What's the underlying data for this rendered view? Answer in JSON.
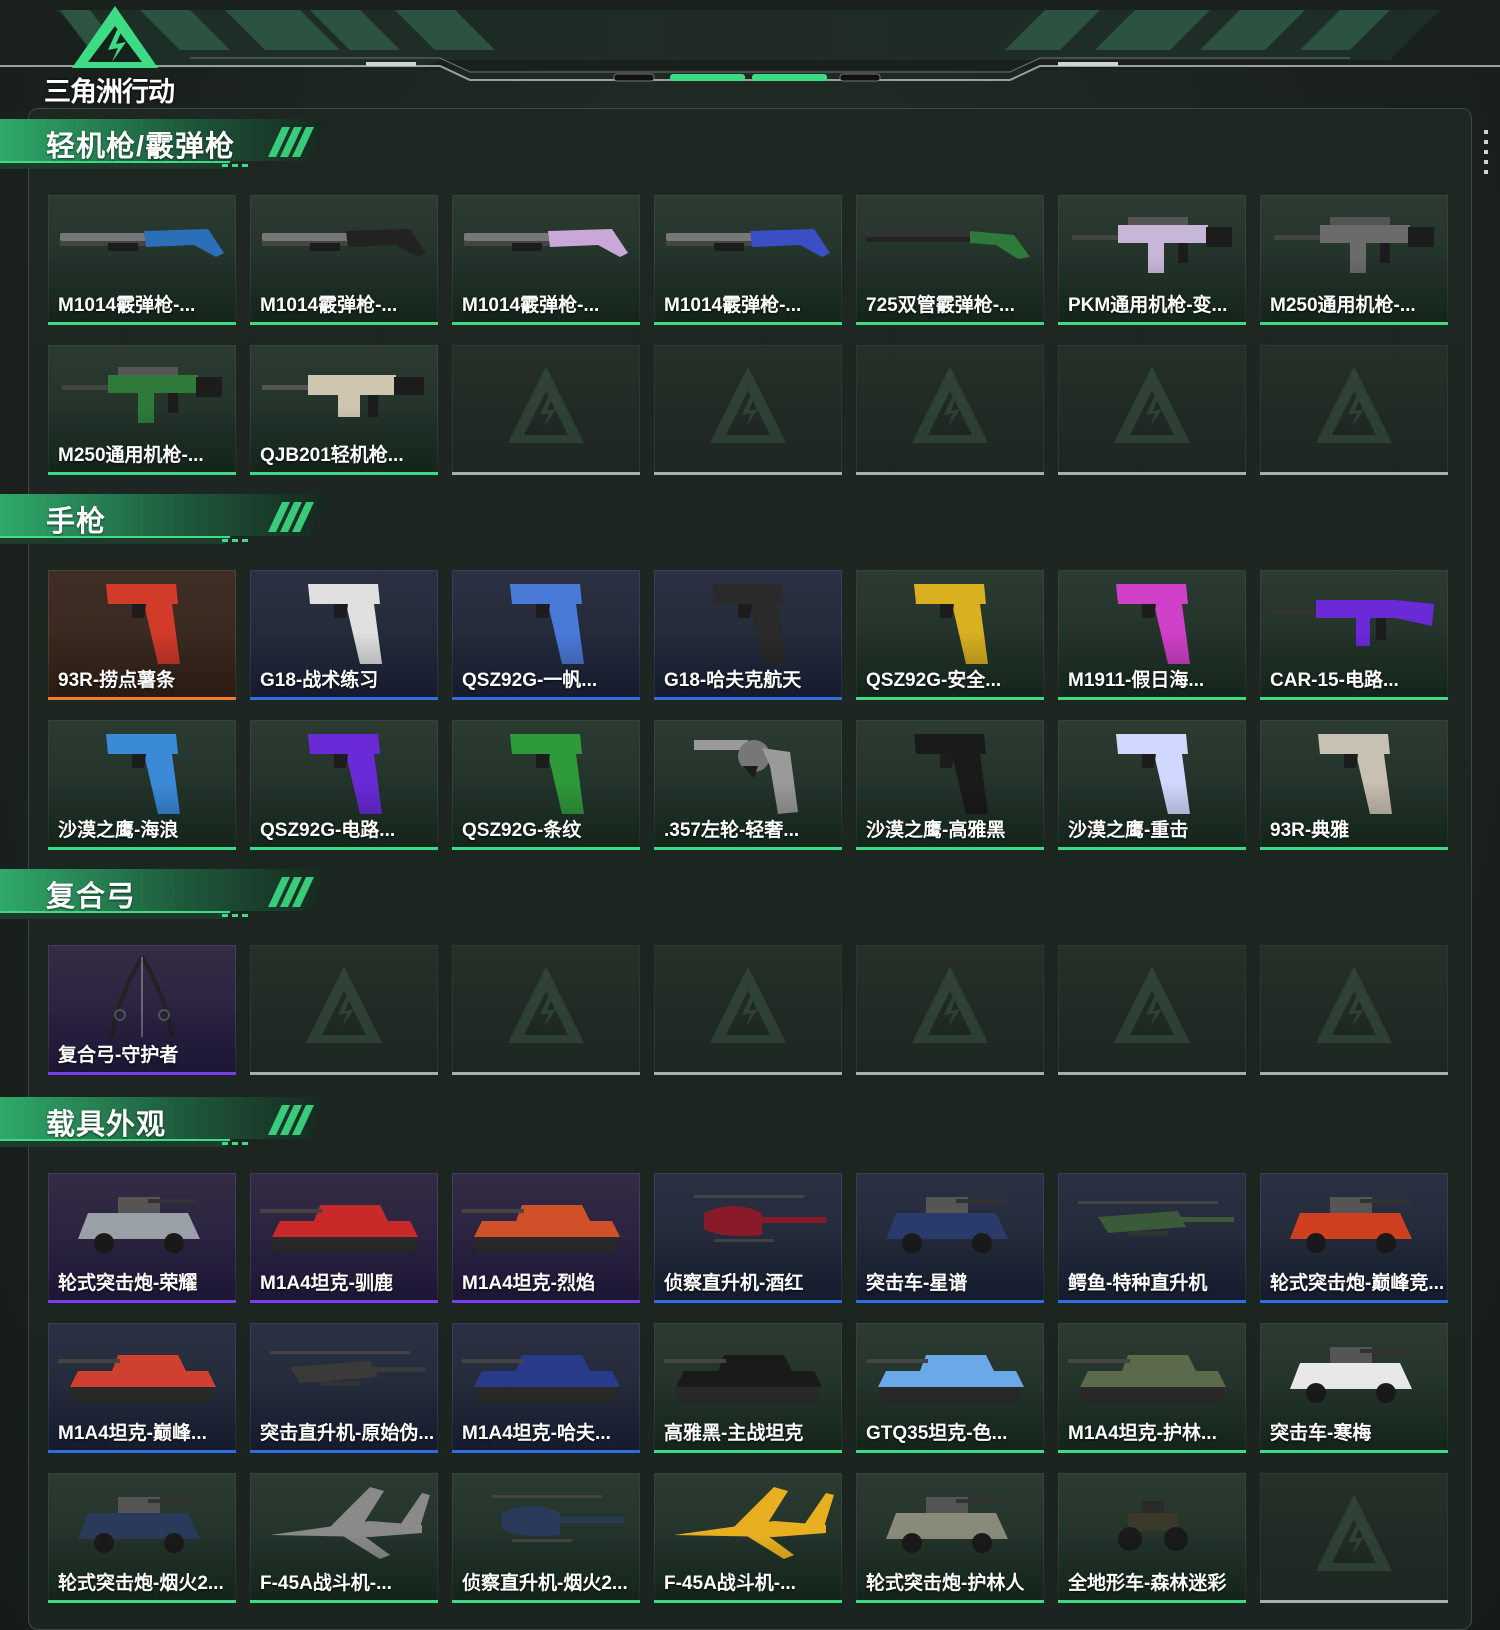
{
  "header": {
    "logo_text": "三角洲行动"
  },
  "colors": {
    "accent": "#3ddc84",
    "blue": "#2f6ee0",
    "purple": "#7a3ee6",
    "orange": "#f07c28",
    "empty": "#a9b0ac"
  },
  "sections": [
    {
      "title": "轻机枪/霰弹枪",
      "items": [
        {
          "label": "M1014霰弹枪-...",
          "rarity": "green",
          "icon": "shotgun-icon",
          "tint": "#2a6fb8"
        },
        {
          "label": "M1014霰弹枪-...",
          "rarity": "green",
          "icon": "shotgun-icon",
          "tint": "#222222"
        },
        {
          "label": "M1014霰弹枪-...",
          "rarity": "green",
          "icon": "shotgun-icon",
          "tint": "#c9a7d6"
        },
        {
          "label": "M1014霰弹枪-...",
          "rarity": "green",
          "icon": "shotgun-icon",
          "tint": "#3a4fc4"
        },
        {
          "label": "725双管霰弹枪-...",
          "rarity": "green",
          "icon": "double-barrel-shotgun-icon",
          "tint": "#2f7a3a"
        },
        {
          "label": "PKM通用机枪-变...",
          "rarity": "green",
          "icon": "machine-gun-icon",
          "tint": "#c8b6d8"
        },
        {
          "label": "M250通用机枪-...",
          "rarity": "green",
          "icon": "machine-gun-icon",
          "tint": "#6b6b6b"
        },
        {
          "label": "M250通用机枪-...",
          "rarity": "green",
          "icon": "machine-gun-icon",
          "tint": "#2f7a3a"
        },
        {
          "label": "QJB201轻机枪...",
          "rarity": "green",
          "icon": "light-machine-gun-icon",
          "tint": "#cfc6b0"
        },
        {
          "label": "",
          "rarity": "empty"
        },
        {
          "label": "",
          "rarity": "empty"
        },
        {
          "label": "",
          "rarity": "empty"
        },
        {
          "label": "",
          "rarity": "empty"
        },
        {
          "label": "",
          "rarity": "empty"
        }
      ]
    },
    {
      "title": "手枪",
      "items": [
        {
          "label": "93R-捞点薯条",
          "rarity": "orange",
          "icon": "pistol-icon",
          "tint": "#d23a2a"
        },
        {
          "label": "G18-战术练习",
          "rarity": "blue",
          "icon": "pistol-icon",
          "tint": "#e0e0e0"
        },
        {
          "label": "QSZ92G-一帆...",
          "rarity": "blue",
          "icon": "pistol-icon",
          "tint": "#4a7ad8"
        },
        {
          "label": "G18-哈夫克航天",
          "rarity": "blue",
          "icon": "pistol-icon",
          "tint": "#2a2a2a"
        },
        {
          "label": "QSZ92G-安全...",
          "rarity": "green",
          "icon": "pistol-icon",
          "tint": "#d8b020"
        },
        {
          "label": "M1911-假日海...",
          "rarity": "green",
          "icon": "pistol-icon",
          "tint": "#d040c8"
        },
        {
          "label": "CAR-15-电路...",
          "rarity": "green",
          "icon": "rifle-icon",
          "tint": "#6a2ad8"
        },
        {
          "label": "沙漠之鹰-海浪",
          "rarity": "green",
          "icon": "pistol-icon",
          "tint": "#3a8ad8"
        },
        {
          "label": "QSZ92G-电路...",
          "rarity": "green",
          "icon": "pistol-icon",
          "tint": "#6a2ad8"
        },
        {
          "label": "QSZ92G-条纹",
          "rarity": "green",
          "icon": "pistol-icon",
          "tint": "#2f9a3a"
        },
        {
          "label": ".357左轮-轻奢...",
          "rarity": "green",
          "icon": "revolver-icon",
          "tint": "#9a9a9a"
        },
        {
          "label": "沙漠之鹰-高雅黑",
          "rarity": "green",
          "icon": "pistol-icon",
          "tint": "#1a1a1a"
        },
        {
          "label": "沙漠之鹰-重击",
          "rarity": "green",
          "icon": "pistol-icon",
          "tint": "#d0d8ff"
        },
        {
          "label": "93R-典雅",
          "rarity": "green",
          "icon": "pistol-icon",
          "tint": "#c8c0b0"
        }
      ]
    },
    {
      "title": "复合弓",
      "items": [
        {
          "label": "复合弓-守护者",
          "rarity": "purple",
          "icon": "compound-bow-icon",
          "tint": "#222222"
        },
        {
          "label": "",
          "rarity": "empty"
        },
        {
          "label": "",
          "rarity": "empty"
        },
        {
          "label": "",
          "rarity": "empty"
        },
        {
          "label": "",
          "rarity": "empty"
        },
        {
          "label": "",
          "rarity": "empty"
        },
        {
          "label": "",
          "rarity": "empty"
        }
      ]
    },
    {
      "title": "载具外观",
      "items": [
        {
          "label": "轮式突击炮-荣耀",
          "rarity": "purple",
          "icon": "armored-car-icon",
          "tint": "#9aa0a8"
        },
        {
          "label": "M1A4坦克-驯鹿",
          "rarity": "purple",
          "icon": "tank-icon",
          "tint": "#c82a2a"
        },
        {
          "label": "M1A4坦克-烈焰",
          "rarity": "purple",
          "icon": "tank-icon",
          "tint": "#d0502a"
        },
        {
          "label": "侦察直升机-酒红",
          "rarity": "blue",
          "icon": "helicopter-icon",
          "tint": "#8a1a2a"
        },
        {
          "label": "突击车-星谱",
          "rarity": "blue",
          "icon": "armored-car-icon",
          "tint": "#2a3a6a"
        },
        {
          "label": "鳄鱼-特种直升机",
          "rarity": "blue",
          "icon": "attack-helicopter-icon",
          "tint": "#3a5a3a"
        },
        {
          "label": "轮式突击炮-巅峰竞...",
          "rarity": "blue",
          "icon": "armored-car-icon",
          "tint": "#d04020"
        },
        {
          "label": "M1A4坦克-巅峰...",
          "rarity": "blue",
          "icon": "tank-icon",
          "tint": "#d04030"
        },
        {
          "label": "突击直升机-原始伪...",
          "rarity": "blue",
          "icon": "attack-helicopter-icon",
          "tint": "#3a3a3a"
        },
        {
          "label": "M1A4坦克-哈夫...",
          "rarity": "blue",
          "icon": "tank-icon",
          "tint": "#2a3a8a"
        },
        {
          "label": "高雅黑-主战坦克",
          "rarity": "green",
          "icon": "tank-icon",
          "tint": "#1a1a1a"
        },
        {
          "label": "GTQ35坦克-色...",
          "rarity": "green",
          "icon": "tank-icon",
          "tint": "#6aa8e8"
        },
        {
          "label": "M1A4坦克-护林...",
          "rarity": "green",
          "icon": "tank-icon",
          "tint": "#5a6a4a"
        },
        {
          "label": "突击车-寒梅",
          "rarity": "green",
          "icon": "armored-car-icon",
          "tint": "#e8e8e8"
        },
        {
          "label": "轮式突击炮-烟火2...",
          "rarity": "green",
          "icon": "armored-car-icon",
          "tint": "#2a3a5a"
        },
        {
          "label": "F-45A战斗机-...",
          "rarity": "green",
          "icon": "fighter-jet-icon",
          "tint": "#8a8a8a"
        },
        {
          "label": "侦察直升机-烟火2...",
          "rarity": "green",
          "icon": "helicopter-icon",
          "tint": "#2a3a5a"
        },
        {
          "label": "F-45A战斗机-...",
          "rarity": "green",
          "icon": "fighter-jet-icon",
          "tint": "#e8b020"
        },
        {
          "label": "轮式突击炮-护林人",
          "rarity": "green",
          "icon": "armored-car-icon",
          "tint": "#8a8a7a"
        },
        {
          "label": "全地形车-森林迷彩",
          "rarity": "green",
          "icon": "atv-icon",
          "tint": "#3a3a2a"
        },
        {
          "label": "",
          "rarity": "empty"
        }
      ]
    }
  ]
}
